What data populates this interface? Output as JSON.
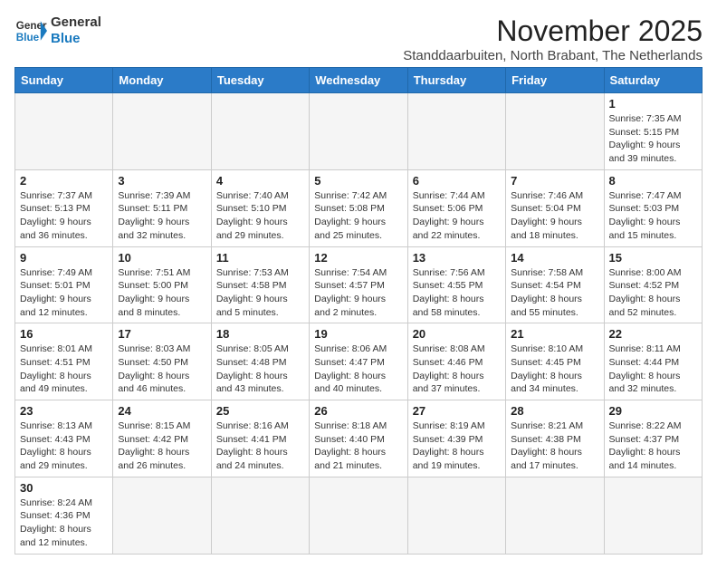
{
  "header": {
    "logo_general": "General",
    "logo_blue": "Blue",
    "month_title": "November 2025",
    "location": "Standdaarbuiten, North Brabant, The Netherlands"
  },
  "weekdays": [
    "Sunday",
    "Monday",
    "Tuesday",
    "Wednesday",
    "Thursday",
    "Friday",
    "Saturday"
  ],
  "weeks": [
    [
      {
        "day": "",
        "info": ""
      },
      {
        "day": "",
        "info": ""
      },
      {
        "day": "",
        "info": ""
      },
      {
        "day": "",
        "info": ""
      },
      {
        "day": "",
        "info": ""
      },
      {
        "day": "",
        "info": ""
      },
      {
        "day": "1",
        "info": "Sunrise: 7:35 AM\nSunset: 5:15 PM\nDaylight: 9 hours and 39 minutes."
      }
    ],
    [
      {
        "day": "2",
        "info": "Sunrise: 7:37 AM\nSunset: 5:13 PM\nDaylight: 9 hours and 36 minutes."
      },
      {
        "day": "3",
        "info": "Sunrise: 7:39 AM\nSunset: 5:11 PM\nDaylight: 9 hours and 32 minutes."
      },
      {
        "day": "4",
        "info": "Sunrise: 7:40 AM\nSunset: 5:10 PM\nDaylight: 9 hours and 29 minutes."
      },
      {
        "day": "5",
        "info": "Sunrise: 7:42 AM\nSunset: 5:08 PM\nDaylight: 9 hours and 25 minutes."
      },
      {
        "day": "6",
        "info": "Sunrise: 7:44 AM\nSunset: 5:06 PM\nDaylight: 9 hours and 22 minutes."
      },
      {
        "day": "7",
        "info": "Sunrise: 7:46 AM\nSunset: 5:04 PM\nDaylight: 9 hours and 18 minutes."
      },
      {
        "day": "8",
        "info": "Sunrise: 7:47 AM\nSunset: 5:03 PM\nDaylight: 9 hours and 15 minutes."
      }
    ],
    [
      {
        "day": "9",
        "info": "Sunrise: 7:49 AM\nSunset: 5:01 PM\nDaylight: 9 hours and 12 minutes."
      },
      {
        "day": "10",
        "info": "Sunrise: 7:51 AM\nSunset: 5:00 PM\nDaylight: 9 hours and 8 minutes."
      },
      {
        "day": "11",
        "info": "Sunrise: 7:53 AM\nSunset: 4:58 PM\nDaylight: 9 hours and 5 minutes."
      },
      {
        "day": "12",
        "info": "Sunrise: 7:54 AM\nSunset: 4:57 PM\nDaylight: 9 hours and 2 minutes."
      },
      {
        "day": "13",
        "info": "Sunrise: 7:56 AM\nSunset: 4:55 PM\nDaylight: 8 hours and 58 minutes."
      },
      {
        "day": "14",
        "info": "Sunrise: 7:58 AM\nSunset: 4:54 PM\nDaylight: 8 hours and 55 minutes."
      },
      {
        "day": "15",
        "info": "Sunrise: 8:00 AM\nSunset: 4:52 PM\nDaylight: 8 hours and 52 minutes."
      }
    ],
    [
      {
        "day": "16",
        "info": "Sunrise: 8:01 AM\nSunset: 4:51 PM\nDaylight: 8 hours and 49 minutes."
      },
      {
        "day": "17",
        "info": "Sunrise: 8:03 AM\nSunset: 4:50 PM\nDaylight: 8 hours and 46 minutes."
      },
      {
        "day": "18",
        "info": "Sunrise: 8:05 AM\nSunset: 4:48 PM\nDaylight: 8 hours and 43 minutes."
      },
      {
        "day": "19",
        "info": "Sunrise: 8:06 AM\nSunset: 4:47 PM\nDaylight: 8 hours and 40 minutes."
      },
      {
        "day": "20",
        "info": "Sunrise: 8:08 AM\nSunset: 4:46 PM\nDaylight: 8 hours and 37 minutes."
      },
      {
        "day": "21",
        "info": "Sunrise: 8:10 AM\nSunset: 4:45 PM\nDaylight: 8 hours and 34 minutes."
      },
      {
        "day": "22",
        "info": "Sunrise: 8:11 AM\nSunset: 4:44 PM\nDaylight: 8 hours and 32 minutes."
      }
    ],
    [
      {
        "day": "23",
        "info": "Sunrise: 8:13 AM\nSunset: 4:43 PM\nDaylight: 8 hours and 29 minutes."
      },
      {
        "day": "24",
        "info": "Sunrise: 8:15 AM\nSunset: 4:42 PM\nDaylight: 8 hours and 26 minutes."
      },
      {
        "day": "25",
        "info": "Sunrise: 8:16 AM\nSunset: 4:41 PM\nDaylight: 8 hours and 24 minutes."
      },
      {
        "day": "26",
        "info": "Sunrise: 8:18 AM\nSunset: 4:40 PM\nDaylight: 8 hours and 21 minutes."
      },
      {
        "day": "27",
        "info": "Sunrise: 8:19 AM\nSunset: 4:39 PM\nDaylight: 8 hours and 19 minutes."
      },
      {
        "day": "28",
        "info": "Sunrise: 8:21 AM\nSunset: 4:38 PM\nDaylight: 8 hours and 17 minutes."
      },
      {
        "day": "29",
        "info": "Sunrise: 8:22 AM\nSunset: 4:37 PM\nDaylight: 8 hours and 14 minutes."
      }
    ],
    [
      {
        "day": "30",
        "info": "Sunrise: 8:24 AM\nSunset: 4:36 PM\nDaylight: 8 hours and 12 minutes."
      },
      {
        "day": "",
        "info": ""
      },
      {
        "day": "",
        "info": ""
      },
      {
        "day": "",
        "info": ""
      },
      {
        "day": "",
        "info": ""
      },
      {
        "day": "",
        "info": ""
      },
      {
        "day": "",
        "info": ""
      }
    ]
  ]
}
